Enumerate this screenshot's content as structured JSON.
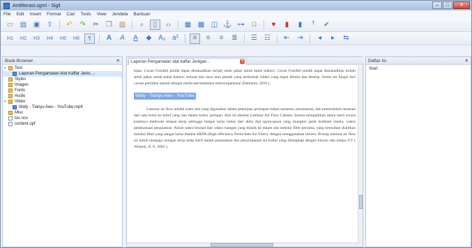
{
  "window": {
    "title": "Antiliterasi.sgml - Sigil",
    "controls": {
      "minimize": "–",
      "maximize": "□",
      "close": "✕"
    }
  },
  "menu": [
    "File",
    "Edit",
    "Insert",
    "Format",
    "Cari",
    "Tools",
    "View",
    "Jendela",
    "Bantuan"
  ],
  "toolbar1": [
    "new-icon",
    "open-icon",
    "save-icon",
    "upload-icon",
    "undo-icon",
    "redo-icon",
    "cut-icon",
    "copy-icon",
    "paste-icon",
    "find-icon",
    "book-view-icon",
    "split-view-icon",
    "insert-image-icon",
    "insert-table-icon",
    "insert-code-icon",
    "anchor-icon",
    "link-icon",
    "special-char-icon",
    "heart-icon",
    "validate-icon",
    "check-icon"
  ],
  "toolbar2": [
    "heading-1-icon",
    "heading-2-icon",
    "heading-3-icon",
    "heading-4-icon",
    "heading-5-icon",
    "heading-6-icon",
    "normal-text-icon",
    "bold-icon",
    "italic-icon",
    "underline-icon",
    "strikethrough-icon",
    "subscript-icon",
    "superscript-icon",
    "align-left-icon",
    "align-center-icon",
    "align-right-icon",
    "justify-icon",
    "bullets-icon",
    "numbering-icon",
    "decrease-indent-icon",
    "increase-indent-icon",
    "rtl-icon",
    "ltr-icon"
  ],
  "left_panel": {
    "header": "Book Browser",
    "tree": [
      {
        "label": "Text",
        "icon": "folder",
        "level": 0,
        "twisty": "▾"
      },
      {
        "label": "Laporan Pengamatan Alat Kaffar Jenis ...",
        "icon": "doc-blue",
        "level": 1,
        "selected": true
      },
      {
        "label": "Styles",
        "icon": "folder",
        "level": 0
      },
      {
        "label": "Images",
        "icon": "folder",
        "level": 0
      },
      {
        "label": "Fonts",
        "icon": "folder",
        "level": 0
      },
      {
        "label": "Audio",
        "icon": "folder",
        "level": 0
      },
      {
        "label": "Video",
        "icon": "folder",
        "level": 0,
        "twisty": "▾"
      },
      {
        "label": "Wafy - Tlanyu Awu - YouTube.mp4",
        "icon": "doc-blue",
        "level": 1
      },
      {
        "label": "Misc",
        "icon": "folder",
        "level": 0
      },
      {
        "label": "toc.ncx",
        "icon": "doc",
        "level": 0
      },
      {
        "label": "content.opf",
        "icon": "doc",
        "level": 0
      }
    ]
  },
  "editor": {
    "tab_label": "Laporan Pengamatan alat kaffar Jenigan..."
  },
  "document": {
    "para1": "bijau. Cavan Fosidbil pindik dapat dimanadikan terbali selali pakai untuk kakai bakteri. Cavan Fosidbil pindik dapat dimanadikan terbali selali pakai untuk kakai bakteri, terbuat dari kaca atau plastik yang berbentuk silider yang dapat dibuka dan ditutup. Selain itu fungsi dari cawan petridisk adalah sebagai media pertumbuhan mikroorganisme (Dalhamn, 2010 ).",
    "heading": "Wafy - Tlanyu Awu - YouTube",
    "para2": "Laminar air flow adalah suatu alat yang digunakan dalam pekerjaan persiapan bahan tanaman, penanaman, dan pemindahan tanaman dari satu botol ke botol yang lain dalam kultur jaringan. Alat ini disebut Laminar Air Flow Cabinet, karena mengalirkan udara steril secara kontinyu melewati tempat kerja sehingga tempat kerja bebas dari debu dan spora-spora yang mungkin jatuh kedalam media, waktu pelaksanaan penanaman. Aliran udara berasal dari udara ruangan yang ditarik ke dalam alat melalui filter pertama, yang kemudian dialirkan melalui filter yang sangat halus disebut HEPA (High efficiency Particulate Air Filter), dengan menggunakan blower. Prinsip laminar air flow ini untuk menjaga ruangan kerja tetap steril dalam penanaman dan penyimpanan sel kultur yang dilengkapi dengan blower dan lampu UV ( Widarsi, D. E. 2002 )."
  },
  "right_panel": {
    "header": "Daftar Isi",
    "rows": [
      "Start"
    ]
  }
}
